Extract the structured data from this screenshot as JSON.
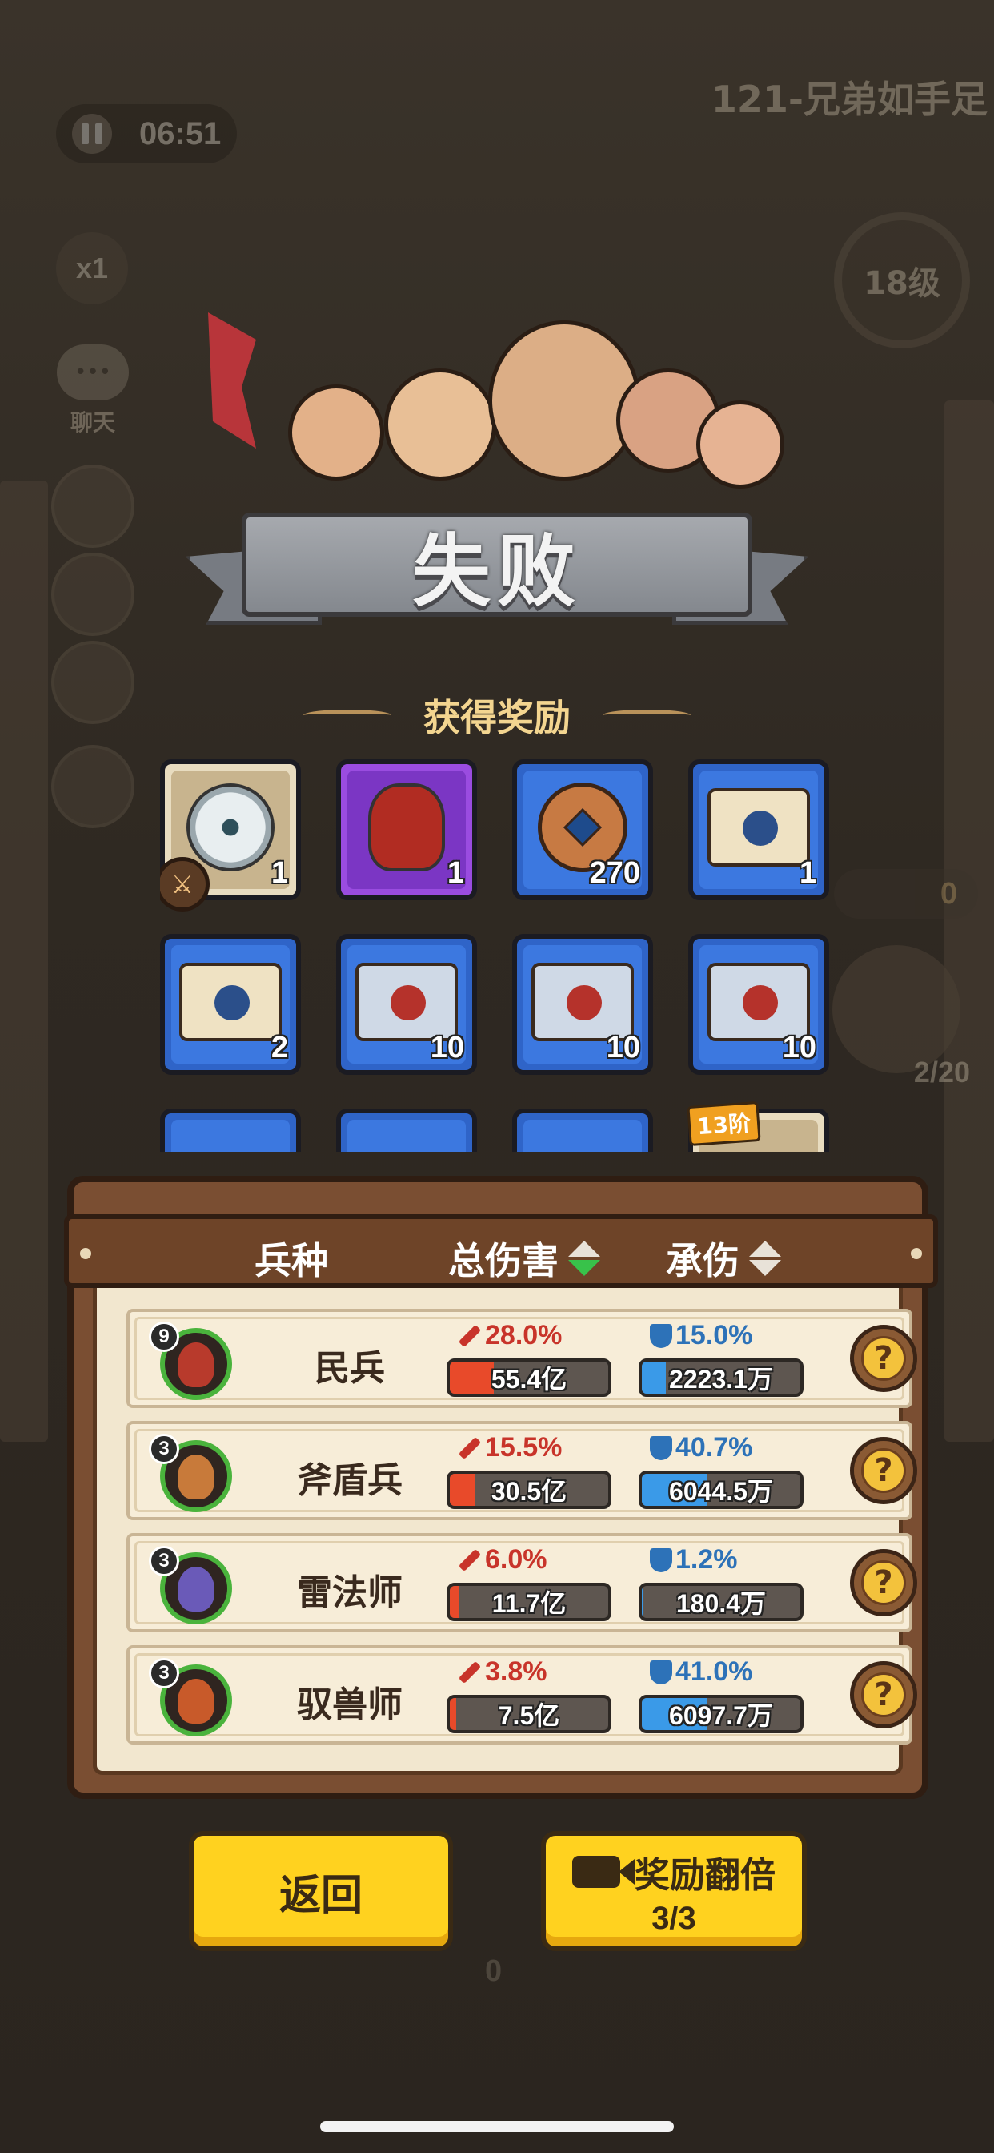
{
  "hud": {
    "timer": "06:51",
    "stage_title": "121-兄弟如手足",
    "speed": "x1",
    "chat_label": "聊天",
    "level": "18级",
    "right_count": "0",
    "population": "2/20",
    "bottom_counter": "0"
  },
  "result": {
    "title": "失败",
    "rewards_title": "获得奖励"
  },
  "rewards": [
    {
      "icon": "jade-disc-icon",
      "quality": "white",
      "qty": "1"
    },
    {
      "icon": "wine-jar-icon",
      "quality": "purple",
      "qty": "1"
    },
    {
      "icon": "copper-coin-icon",
      "quality": "blue",
      "qty": "270"
    },
    {
      "icon": "armor-scroll-icon",
      "quality": "blue",
      "qty": "1"
    },
    {
      "icon": "helmet-scroll-icon",
      "quality": "blue",
      "qty": "2"
    },
    {
      "icon": "horse-scroll-icon",
      "quality": "blue",
      "qty": "10"
    },
    {
      "icon": "blade-scroll-icon",
      "quality": "blue",
      "qty": "10"
    },
    {
      "icon": "fist-scroll-icon",
      "quality": "blue",
      "qty": "10"
    }
  ],
  "tier_tag": "13阶",
  "stats": {
    "headers": {
      "unit": "兵种",
      "damage": "总伤害",
      "taken": "承伤"
    },
    "rows": [
      {
        "level": "9",
        "name": "民兵",
        "dmg_pct": "28.0%",
        "dmg_val": "55.4亿",
        "dmg_fill": 0.28,
        "tank_pct": "15.0%",
        "tank_val": "2223.1万",
        "tank_fill": 0.15,
        "color": "#b83a2c"
      },
      {
        "level": "3",
        "name": "斧盾兵",
        "dmg_pct": "15.5%",
        "dmg_val": "30.5亿",
        "dmg_fill": 0.155,
        "tank_pct": "40.7%",
        "tank_val": "6044.5万",
        "tank_fill": 0.407,
        "color": "#c87a3a"
      },
      {
        "level": "3",
        "name": "雷法师",
        "dmg_pct": "6.0%",
        "dmg_val": "11.7亿",
        "dmg_fill": 0.06,
        "tank_pct": "1.2%",
        "tank_val": "180.4万",
        "tank_fill": 0.012,
        "color": "#6a5ab8"
      },
      {
        "level": "3",
        "name": "驭兽师",
        "dmg_pct": "3.8%",
        "dmg_val": "7.5亿",
        "dmg_fill": 0.038,
        "tank_pct": "41.0%",
        "tank_val": "6097.7万",
        "tank_fill": 0.41,
        "color": "#c85a2a"
      }
    ]
  },
  "buttons": {
    "back": "返回",
    "double": "奖励翻倍",
    "double_count": "3/3"
  }
}
